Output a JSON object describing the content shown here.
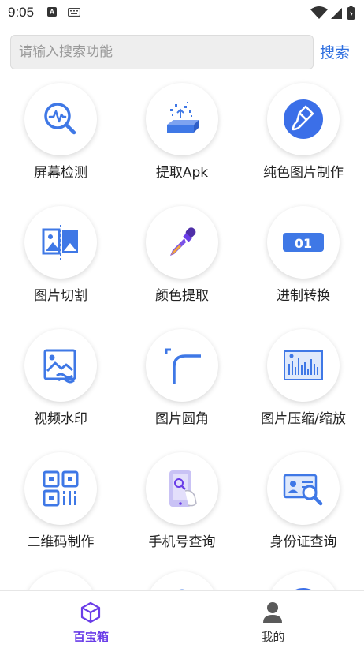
{
  "status_bar": {
    "time": "9:05",
    "notification_icon_text": "A"
  },
  "search": {
    "placeholder": "请输入搜索功能",
    "button_label": "搜索"
  },
  "tools": [
    {
      "label": "屏幕检测",
      "icon": "screen-detect-icon"
    },
    {
      "label": "提取Apk",
      "icon": "extract-apk-icon"
    },
    {
      "label": "纯色图片制作",
      "icon": "solid-color-brush-icon"
    },
    {
      "label": "图片切割",
      "icon": "image-cut-icon"
    },
    {
      "label": "颜色提取",
      "icon": "color-picker-icon"
    },
    {
      "label": "进制转换",
      "icon": "base-convert-icon",
      "icon_text": "01"
    },
    {
      "label": "视频水印",
      "icon": "video-watermark-icon"
    },
    {
      "label": "图片圆角",
      "icon": "image-round-corner-icon"
    },
    {
      "label": "图片压缩/缩放",
      "icon": "image-compress-icon"
    },
    {
      "label": "二维码制作",
      "icon": "qrcode-icon"
    },
    {
      "label": "手机号查询",
      "icon": "phone-lookup-icon"
    },
    {
      "label": "身份证查询",
      "icon": "id-card-lookup-icon"
    }
  ],
  "bottom_nav": [
    {
      "label": "百宝箱",
      "icon": "toolbox-cube-icon",
      "active": true
    },
    {
      "label": "我的",
      "icon": "user-icon",
      "active": false
    }
  ],
  "colors": {
    "accent_blue": "#3f78e6",
    "active_purple": "#6a3de8",
    "brush_blue": "#3b6fe8"
  }
}
